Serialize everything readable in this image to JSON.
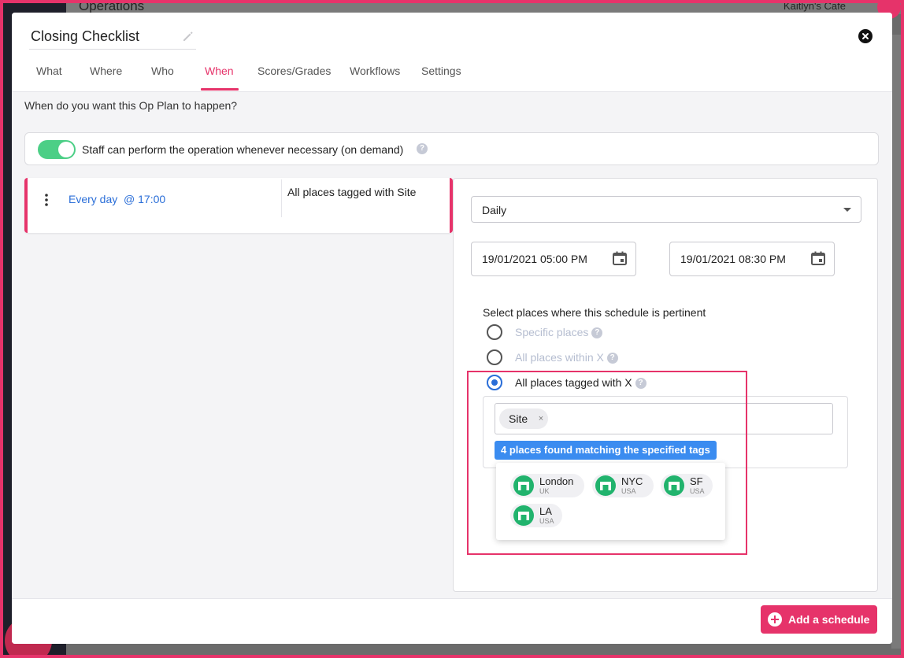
{
  "background": {
    "title": "Operations",
    "user": "Kaitlyn's Cafe"
  },
  "modal": {
    "title": "Closing Checklist",
    "tabs": [
      {
        "label": "What"
      },
      {
        "label": "Where"
      },
      {
        "label": "Who"
      },
      {
        "label": "When"
      },
      {
        "label": "Scores/Grades"
      },
      {
        "label": "Workflows"
      },
      {
        "label": "Settings"
      }
    ],
    "active_tab": "When",
    "question": "When do you want this Op Plan to happen?",
    "on_demand": {
      "label": "Staff can perform the operation whenever necessary (on demand)",
      "enabled": true
    },
    "schedule": {
      "time": "Every day  @ 17:00",
      "places": "All places tagged with Site"
    },
    "editor": {
      "frequency": "Daily",
      "start": "19/01/2021 05:00 PM",
      "end": "19/01/2021 08:30 PM",
      "places_label": "Select places where this schedule is pertinent",
      "options": [
        {
          "label": "Specific places"
        },
        {
          "label": "All places within X"
        },
        {
          "label": "All places tagged with X"
        }
      ],
      "selected_option": "All places tagged with X",
      "tag": "Site",
      "tag_remove": "×",
      "match_text": "4 places found matching the specified tags",
      "places": [
        {
          "name": "London",
          "country": "UK"
        },
        {
          "name": "NYC",
          "country": "USA"
        },
        {
          "name": "SF",
          "country": "USA"
        },
        {
          "name": "LA",
          "country": "USA"
        }
      ]
    },
    "add_button": "Add a schedule"
  },
  "colors": {
    "accent": "#e6336a",
    "link": "#2a6ed8",
    "toggle": "#4ccf86",
    "place_icon": "#21b36d",
    "match_badge": "#3b8cf0"
  }
}
